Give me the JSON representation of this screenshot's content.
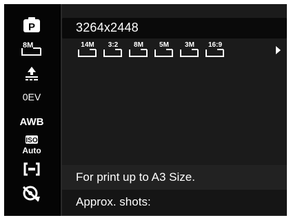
{
  "sidebar": {
    "items": [
      {
        "icon": "program-mode-icon",
        "label": "P"
      },
      {
        "icon": "image-size-8m-icon",
        "label": "8M"
      },
      {
        "icon": "quality-icon"
      },
      {
        "icon": "ev-icon",
        "label": "0EV"
      },
      {
        "icon": "white-balance-icon",
        "label": "AWB"
      },
      {
        "icon": "iso-auto-icon",
        "label_top": "ISO",
        "label_bottom": "Auto"
      },
      {
        "icon": "metering-icon"
      },
      {
        "icon": "color-effect-icon"
      }
    ]
  },
  "main": {
    "title": "3264x2448",
    "size_options": [
      {
        "label": "14M",
        "name": "size-option-14m",
        "selected": false
      },
      {
        "label": "3:2",
        "name": "size-option-3-2",
        "selected": false
      },
      {
        "label": "8M",
        "name": "size-option-8m",
        "selected": true
      },
      {
        "label": "5M",
        "name": "size-option-5m",
        "selected": false
      },
      {
        "label": "3M",
        "name": "size-option-3m",
        "selected": false
      },
      {
        "label": "16:9",
        "name": "size-option-16-9",
        "selected": false
      }
    ],
    "info_line_1": "For print up to A3 Size.",
    "info_line_2": "Approx. shots:"
  },
  "colors": {
    "background": "#000000",
    "panel": "#1b1b1b",
    "title_bar": "#0a0a0a",
    "text": "#ffffff"
  }
}
